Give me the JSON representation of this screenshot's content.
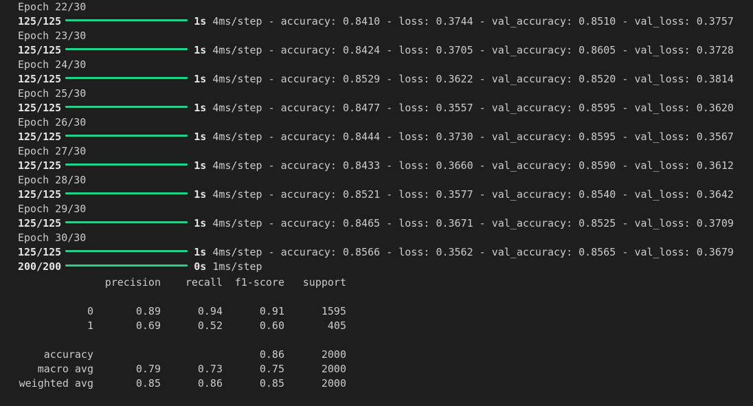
{
  "training": [
    {
      "epoch": "Epoch 22/30",
      "step": "125/125",
      "time": "1s",
      "per_step": "4ms/step",
      "accuracy": "0.8410",
      "loss": "0.3744",
      "val_accuracy": "0.8510",
      "val_loss": "0.3757"
    },
    {
      "epoch": "Epoch 23/30",
      "step": "125/125",
      "time": "1s",
      "per_step": "4ms/step",
      "accuracy": "0.8424",
      "loss": "0.3705",
      "val_accuracy": "0.8605",
      "val_loss": "0.3728"
    },
    {
      "epoch": "Epoch 24/30",
      "step": "125/125",
      "time": "1s",
      "per_step": "4ms/step",
      "accuracy": "0.8529",
      "loss": "0.3622",
      "val_accuracy": "0.8520",
      "val_loss": "0.3814"
    },
    {
      "epoch": "Epoch 25/30",
      "step": "125/125",
      "time": "1s",
      "per_step": "4ms/step",
      "accuracy": "0.8477",
      "loss": "0.3557",
      "val_accuracy": "0.8595",
      "val_loss": "0.3620"
    },
    {
      "epoch": "Epoch 26/30",
      "step": "125/125",
      "time": "1s",
      "per_step": "4ms/step",
      "accuracy": "0.8444",
      "loss": "0.3730",
      "val_accuracy": "0.8595",
      "val_loss": "0.3567"
    },
    {
      "epoch": "Epoch 27/30",
      "step": "125/125",
      "time": "1s",
      "per_step": "4ms/step",
      "accuracy": "0.8433",
      "loss": "0.3660",
      "val_accuracy": "0.8590",
      "val_loss": "0.3612"
    },
    {
      "epoch": "Epoch 28/30",
      "step": "125/125",
      "time": "1s",
      "per_step": "4ms/step",
      "accuracy": "0.8521",
      "loss": "0.3577",
      "val_accuracy": "0.8540",
      "val_loss": "0.3642"
    },
    {
      "epoch": "Epoch 29/30",
      "step": "125/125",
      "time": "1s",
      "per_step": "4ms/step",
      "accuracy": "0.8465",
      "loss": "0.3671",
      "val_accuracy": "0.8525",
      "val_loss": "0.3709"
    },
    {
      "epoch": "Epoch 30/30",
      "step": "125/125",
      "time": "1s",
      "per_step": "4ms/step",
      "accuracy": "0.8566",
      "loss": "0.3562",
      "val_accuracy": "0.8565",
      "val_loss": "0.3679"
    }
  ],
  "labels": {
    "accuracy": "accuracy:",
    "loss": "loss:",
    "val_accuracy": "val_accuracy:",
    "val_loss": "val_loss:",
    "sep": "-"
  },
  "predict": {
    "step": "200/200",
    "time": "0s",
    "per_step": "1ms/step"
  },
  "report": {
    "headers": [
      "",
      "precision",
      "recall",
      "f1-score",
      "support"
    ],
    "rows": [
      [
        "0",
        "0.89",
        "0.94",
        "0.91",
        "1595"
      ],
      [
        "1",
        "0.69",
        "0.52",
        "0.60",
        "405"
      ],
      [
        "",
        "",
        "",
        "",
        ""
      ],
      [
        "accuracy",
        "",
        "",
        "0.86",
        "2000"
      ],
      [
        "macro avg",
        "0.79",
        "0.73",
        "0.75",
        "2000"
      ],
      [
        "weighted avg",
        "0.85",
        "0.86",
        "0.85",
        "2000"
      ]
    ]
  },
  "colors": {
    "background": "#1e1e1e",
    "text": "#cccccc",
    "progress_bar": "#23d18b"
  }
}
